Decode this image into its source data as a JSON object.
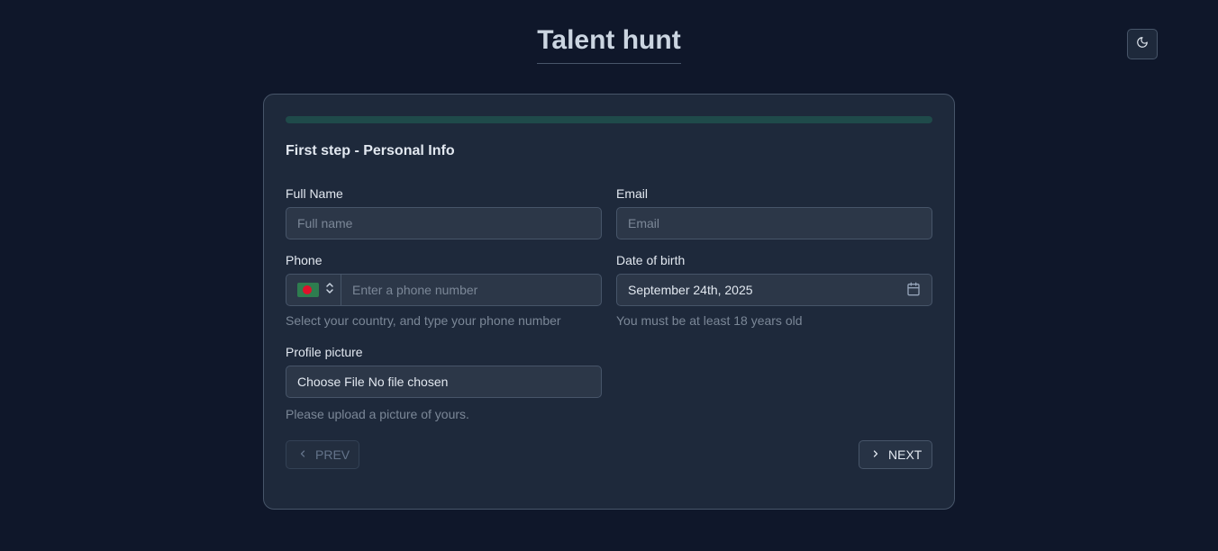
{
  "header": {
    "title": "Talent hunt",
    "theme_toggle_icon": "moon-icon"
  },
  "form": {
    "progress_fraction": 1.0,
    "step_title": "First step - Personal Info",
    "full_name": {
      "label": "Full Name",
      "placeholder": "Full name",
      "value": ""
    },
    "email": {
      "label": "Email",
      "placeholder": "Email",
      "value": ""
    },
    "phone": {
      "label": "Phone",
      "country_flag": "bangladesh-flag-icon",
      "placeholder": "Enter a phone number",
      "value": "",
      "hint": "Select your country, and type your phone number"
    },
    "dob": {
      "label": "Date of birth",
      "value": "September 24th, 2025",
      "hint": "You must be at least 18 years old"
    },
    "profile_picture": {
      "label": "Profile picture",
      "button_label": "Choose File",
      "status": "No file chosen",
      "hint": "Please upload a picture of yours."
    },
    "nav": {
      "prev_label": "PREV",
      "next_label": "NEXT"
    }
  },
  "colors": {
    "background": "#0f172a",
    "card": "#1e293b",
    "progress": "#1f4a4a"
  }
}
